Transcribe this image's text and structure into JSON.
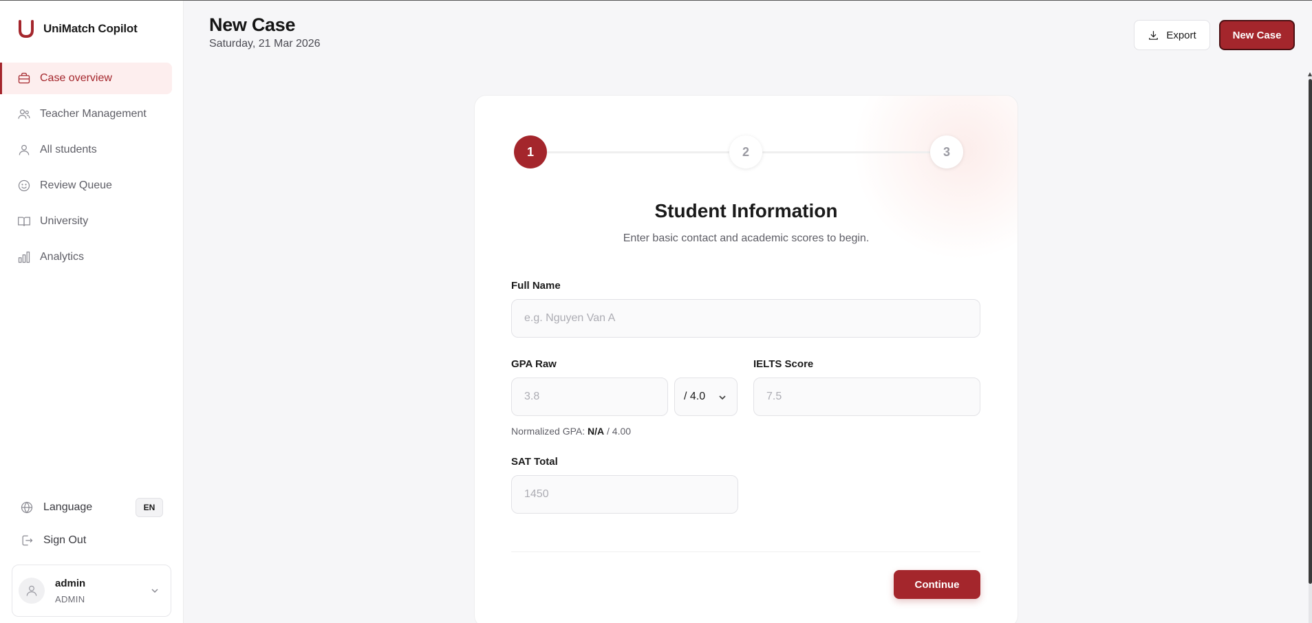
{
  "app": {
    "name": "UniMatch Copilot",
    "logo_letter": "U"
  },
  "colors": {
    "accent": "#a4262c",
    "active_bg": "#fdeeee",
    "page_bg": "#f6f6f8"
  },
  "sidebar": {
    "items": [
      {
        "label": "Case overview",
        "icon": "briefcase-icon",
        "active": true
      },
      {
        "label": "Teacher Management",
        "icon": "users-icon",
        "active": false
      },
      {
        "label": "All students",
        "icon": "user-icon",
        "active": false
      },
      {
        "label": "Review Queue",
        "icon": "smile-icon",
        "active": false
      },
      {
        "label": "University",
        "icon": "book-open-icon",
        "active": false
      },
      {
        "label": "Analytics",
        "icon": "bar-chart-icon",
        "active": false
      }
    ],
    "language": {
      "label": "Language",
      "value": "EN"
    },
    "sign_out": "Sign Out",
    "user": {
      "name": "admin",
      "role": "ADMIN"
    }
  },
  "header": {
    "title": "New Case",
    "date": "Saturday, 21 Mar 2026",
    "export_label": "Export",
    "new_case_label": "New Case"
  },
  "stepper": {
    "steps": [
      "1",
      "2",
      "3"
    ],
    "current": 1
  },
  "form": {
    "title": "Student Information",
    "subtitle": "Enter basic contact and academic scores to begin.",
    "full_name": {
      "label": "Full Name",
      "placeholder": "e.g. Nguyen Van A",
      "value": ""
    },
    "gpa": {
      "label": "GPA Raw",
      "placeholder": "3.8",
      "value": "",
      "scale": "/ 4.0"
    },
    "ielts": {
      "label": "IELTS Score",
      "placeholder": "7.5",
      "value": ""
    },
    "normalized": {
      "prefix": "Normalized GPA:",
      "value": "N/A",
      "suffix": "/ 4.00"
    },
    "sat": {
      "label": "SAT Total",
      "placeholder": "1450",
      "value": ""
    },
    "continue_label": "Continue"
  }
}
